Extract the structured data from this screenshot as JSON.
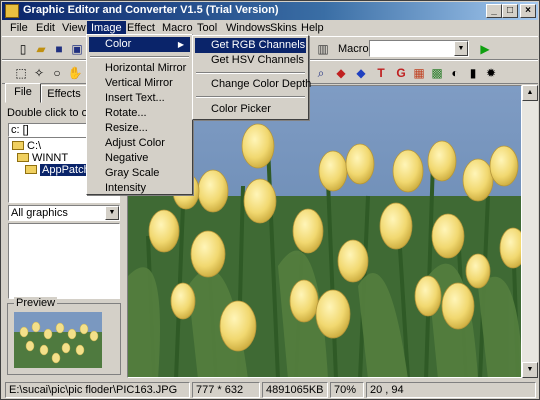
{
  "window": {
    "title": "Graphic Editor and Converter V1.5 (Trial Version)"
  },
  "menubar": [
    "File",
    "Edit",
    "View",
    "Image",
    "Effect",
    "Macro",
    "Tool",
    "Windows",
    "Skins",
    "Help"
  ],
  "toolbar": {
    "macro_label": "Macro:",
    "macro_value": ""
  },
  "left_panel": {
    "tabs": [
      "File",
      "Effects"
    ],
    "hint": "Double click to open",
    "drive": "c: []",
    "tree": [
      "C:\\",
      "WINNT",
      "AppPatch"
    ],
    "filter": "All graphics",
    "preview_label": "Preview"
  },
  "image_menu": {
    "color": "Color",
    "items": [
      "Horizontal Mirror",
      "Vertical Mirror",
      "Insert Text...",
      "Rotate...",
      "Resize...",
      "Adjust Color",
      "Negative",
      "Gray Scale",
      "Intensity"
    ]
  },
  "color_submenu": [
    "Get RGB Channels",
    "Get HSV Channels",
    "Change Color Depth",
    "Color Picker"
  ],
  "status": {
    "path": "E:\\sucai\\pic\\pic floder\\PIC163.JPG",
    "dimensions": "777 * 632",
    "size": "4891065KB",
    "zoom": "70%",
    "coords": "20 , 94"
  },
  "colors": {
    "highlight": "#0a246a",
    "face": "#d4d0c8"
  }
}
